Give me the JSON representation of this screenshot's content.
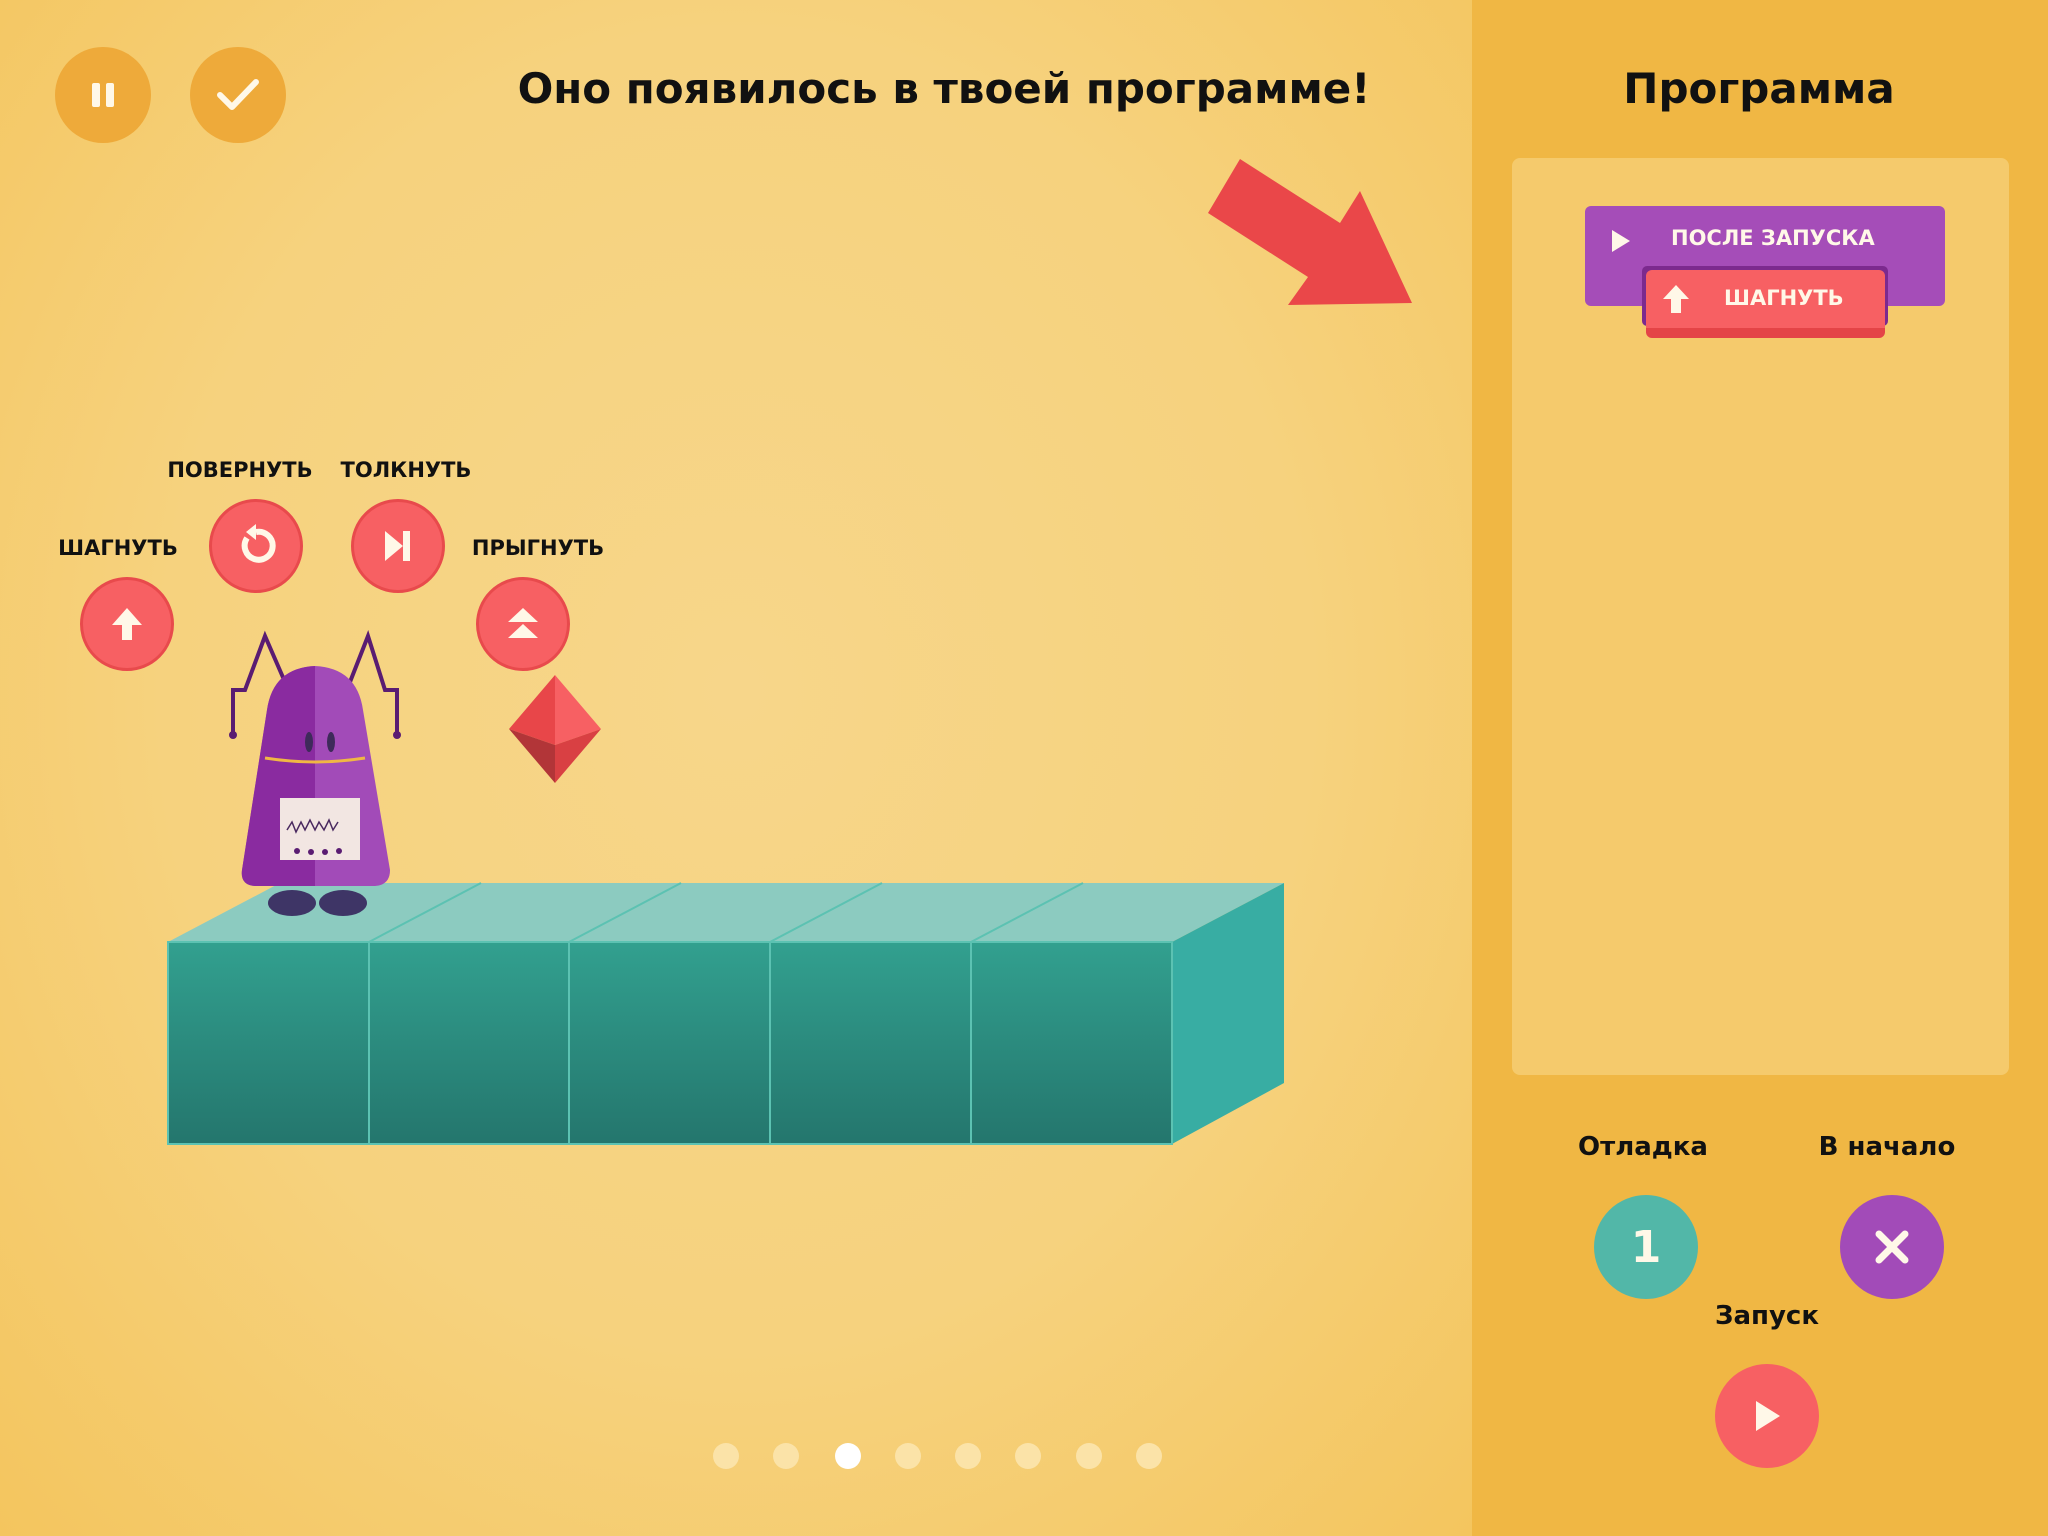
{
  "header": {
    "title": "Оно появилось в твоей программе!",
    "pause_icon": "pause-icon",
    "check_icon": "check-icon"
  },
  "actions": [
    {
      "label": "ШАГНУТЬ",
      "icon": "arrow-up-icon"
    },
    {
      "label": "ПОВЕРНУТЬ",
      "icon": "rotate-icon"
    },
    {
      "label": "ТОЛКНУТЬ",
      "icon": "skip-forward-icon"
    },
    {
      "label": "ПРЫГНУТЬ",
      "icon": "double-chevron-up-icon"
    }
  ],
  "program": {
    "title": "Программа",
    "start_block": "ПОСЛЕ ЗАПУСКА",
    "blocks": [
      {
        "label": "ШАГНУТЬ"
      }
    ]
  },
  "controls": {
    "debug_label": "Отладка",
    "debug_value": "1",
    "reset_label": "В начало",
    "run_label": "Запуск"
  },
  "pagination": {
    "total": 8,
    "current": 3
  },
  "colors": {
    "accent_red": "#f76063",
    "purple": "#a54db8",
    "teal": "#52b7a8",
    "panel": "#f0b744"
  }
}
